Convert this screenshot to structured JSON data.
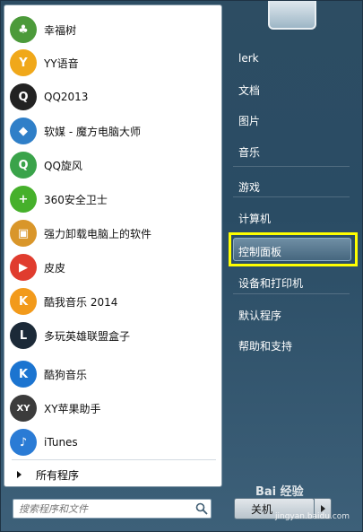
{
  "programs": [
    {
      "label": "幸福树",
      "icon": "tree-icon",
      "glyph": "♣",
      "color": "#4c9a3a"
    },
    {
      "label": "YY语音",
      "icon": "yy-icon",
      "glyph": "Y",
      "color": "#f0a81a"
    },
    {
      "label": "QQ2013",
      "icon": "qq-penguin-icon",
      "glyph": "Q",
      "color": "#222222"
    },
    {
      "label": "软媒 - 魔方电脑大师",
      "icon": "cube-icon",
      "glyph": "◆",
      "color": "#2f7fc8"
    },
    {
      "label": "QQ旋风",
      "icon": "qq-whirlwind-icon",
      "glyph": "Q",
      "color": "#3aa34a"
    },
    {
      "label": "360安全卫士",
      "icon": "shield-360-icon",
      "glyph": "+",
      "color": "#46b02b"
    },
    {
      "label": "强力卸载电脑上的软件",
      "icon": "uninstall-icon",
      "glyph": "▣",
      "color": "#d9962a"
    },
    {
      "label": "皮皮",
      "icon": "pipi-player-icon",
      "glyph": "▶",
      "color": "#e03c2e"
    },
    {
      "label": "酷我音乐 2014",
      "icon": "kuwo-music-icon",
      "glyph": "K",
      "color": "#f29a1b"
    },
    {
      "label": "多玩英雄联盟盒子",
      "icon": "lol-box-icon",
      "glyph": "L",
      "color": "#1c2a38"
    },
    {
      "label": "酷狗音乐",
      "icon": "kugou-music-icon",
      "glyph": "K",
      "color": "#1b74d0"
    },
    {
      "label": "XY苹果助手",
      "icon": "xy-assistant-icon",
      "glyph": "XY",
      "color": "#3b3b3b"
    },
    {
      "label": "iTunes",
      "icon": "itunes-icon",
      "glyph": "♪",
      "color": "#2a7bd5"
    }
  ],
  "all_programs_label": "所有程序",
  "search": {
    "placeholder": "搜索程序和文件"
  },
  "right_items": [
    {
      "label": "lerk",
      "name": "right-item-user"
    },
    {
      "label": "文档",
      "name": "right-item-documents"
    },
    {
      "label": "图片",
      "name": "right-item-pictures"
    },
    {
      "label": "音乐",
      "name": "right-item-music"
    },
    {
      "label": "游戏",
      "name": "right-item-games"
    },
    {
      "label": "计算机",
      "name": "right-item-computer"
    },
    {
      "label": "控制面板",
      "name": "right-item-control-panel"
    },
    {
      "label": "设备和打印机",
      "name": "right-item-devices-printers"
    },
    {
      "label": "默认程序",
      "name": "right-item-default-programs"
    },
    {
      "label": "帮助和支持",
      "name": "right-item-help-support"
    }
  ],
  "shutdown_label": "关机",
  "watermark": {
    "text": "Bai 经验",
    "url": "jingyan.baidu.com"
  },
  "colors": {
    "highlight": "#ffff00"
  }
}
